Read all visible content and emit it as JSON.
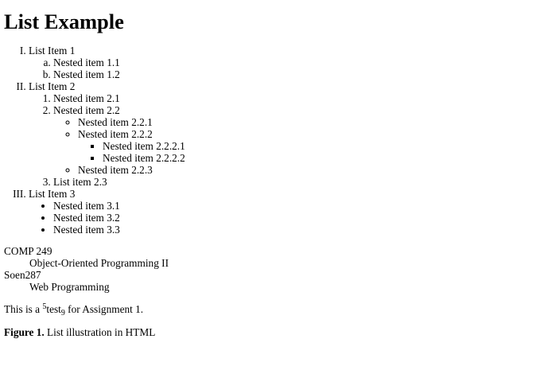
{
  "heading": "List Example",
  "list": {
    "item1": {
      "label": "List Item 1",
      "children": [
        "Nested item 1.1",
        "Nested item 1.2"
      ]
    },
    "item2": {
      "label": "List Item 2",
      "child1": "Nested item 2.1",
      "child2": {
        "label": "Nested item 2.2",
        "sub1": "Nested item 2.2.1",
        "sub2": {
          "label": "Nested item 2.2.2",
          "children": [
            "Nested item 2.2.2.1",
            "Nested item 2.2.2.2"
          ]
        },
        "sub3": "Nested item 2.2.3"
      },
      "child3": "List item 2.3"
    },
    "item3": {
      "label": "List Item 3",
      "children": [
        "Nested item 3.1",
        "Nested item 3.2",
        "Nested item 3.3"
      ]
    }
  },
  "definitions": [
    {
      "term": "COMP 249",
      "description": "Object-Oriented Programming II"
    },
    {
      "term": "Soen287",
      "description": "Web Programming"
    }
  ],
  "sentence": {
    "before": "This is a ",
    "superscript": "5",
    "word": "test",
    "subscript": "9",
    "after": " for Assignment 1."
  },
  "caption": {
    "label": "Figure 1.",
    "text": " List illustration in HTML"
  }
}
